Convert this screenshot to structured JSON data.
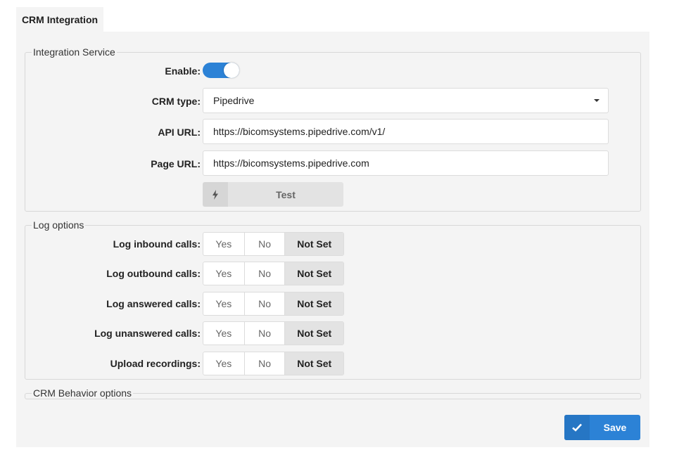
{
  "tab": {
    "label": "CRM Integration"
  },
  "integration_service": {
    "legend": "Integration Service",
    "enable_label": "Enable:",
    "enabled": true,
    "crm_type_label": "CRM type:",
    "crm_type_value": "Pipedrive",
    "api_url_label": "API URL:",
    "api_url_value": "https://bicomsystems.pipedrive.com/v1/",
    "page_url_label": "Page URL:",
    "page_url_value": "https://bicomsystems.pipedrive.com",
    "test_label": "Test",
    "test_icon": "lightning-icon"
  },
  "log_options": {
    "legend": "Log options",
    "option_labels": {
      "yes": "Yes",
      "no": "No",
      "not_set": "Not Set"
    },
    "rows": [
      {
        "label": "Log inbound calls:",
        "selected": "Not Set"
      },
      {
        "label": "Log outbound calls:",
        "selected": "Not Set"
      },
      {
        "label": "Log answered calls:",
        "selected": "Not Set"
      },
      {
        "label": "Log unanswered calls:",
        "selected": "Not Set"
      },
      {
        "label": "Upload recordings:",
        "selected": "Not Set"
      }
    ]
  },
  "crm_behavior": {
    "legend": "CRM Behavior options"
  },
  "footer": {
    "save_label": "Save",
    "save_icon": "checkmark-icon"
  },
  "colors": {
    "accent": "#2c82d6",
    "panel_bg": "#f4f4f4",
    "selected_seg": "#e3e3e3"
  }
}
